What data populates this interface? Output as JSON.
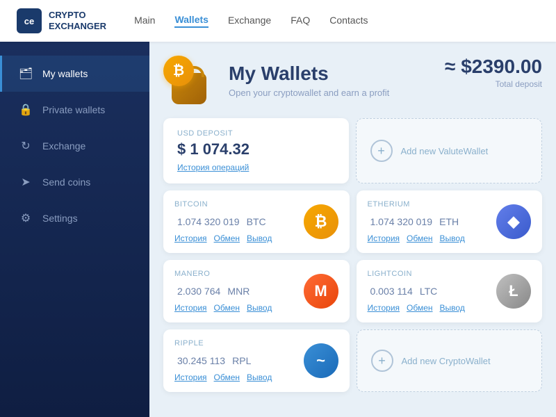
{
  "header": {
    "logo_abbr": "ce",
    "logo_line1": "CRYPTO",
    "logo_line2": "EXCHANGER",
    "nav_items": [
      {
        "label": "Main",
        "active": false
      },
      {
        "label": "Wallets",
        "active": true
      },
      {
        "label": "Exchange",
        "active": false
      },
      {
        "label": "FAQ",
        "active": false
      },
      {
        "label": "Contacts",
        "active": false
      }
    ]
  },
  "sidebar": {
    "items": [
      {
        "label": "My wallets",
        "icon": "🗂",
        "active": true
      },
      {
        "label": "Private wallets",
        "icon": "🔒",
        "active": false
      },
      {
        "label": "Exchange",
        "icon": "↻",
        "active": false
      },
      {
        "label": "Send coins",
        "icon": "➤",
        "active": false
      },
      {
        "label": "Settings",
        "icon": "⚙",
        "active": false
      }
    ]
  },
  "wallets_page": {
    "title": "My Wallets",
    "subtitle": "Open your cryptowallet and earn a profit",
    "total_prefix": "≈",
    "total_amount": "$2390.00",
    "total_label": "Total deposit",
    "usd_card": {
      "label": "USD Deposit",
      "amount": "$ 1 074.32",
      "link": "История операций"
    },
    "add_valute": {
      "plus": "+",
      "label": "Add new ValuteWallet"
    },
    "add_crypto": {
      "plus": "+",
      "label": "Add new CryptoWallet"
    },
    "crypto_cards": [
      {
        "label": "Bitcoin",
        "amount": "1.074 320 019",
        "ticker": "BTC",
        "icon_text": "₿",
        "icon_class": "btc-icon",
        "links": [
          "История",
          "Обмен",
          "Вывод"
        ]
      },
      {
        "label": "Etherium",
        "amount": "1.074 320 019",
        "ticker": "ETH",
        "icon_text": "◆",
        "icon_class": "eth-icon",
        "links": [
          "История",
          "Обмен",
          "Вывод"
        ]
      },
      {
        "label": "Manero",
        "amount": "2.030 764",
        "ticker": "MNR",
        "icon_text": "M",
        "icon_class": "mnr-icon",
        "links": [
          "История",
          "Обмен",
          "Вывод"
        ]
      },
      {
        "label": "Lightcoin",
        "amount": "0.003 114",
        "ticker": "LTC",
        "icon_text": "Ł",
        "icon_class": "ltc-icon",
        "links": [
          "История",
          "Обмен",
          "Вывод"
        ]
      },
      {
        "label": "Ripple",
        "amount": "30.245 113",
        "ticker": "RPL",
        "icon_text": "~",
        "icon_class": "rpl-icon",
        "links": [
          "История",
          "Обмен",
          "Вывод"
        ]
      }
    ]
  }
}
